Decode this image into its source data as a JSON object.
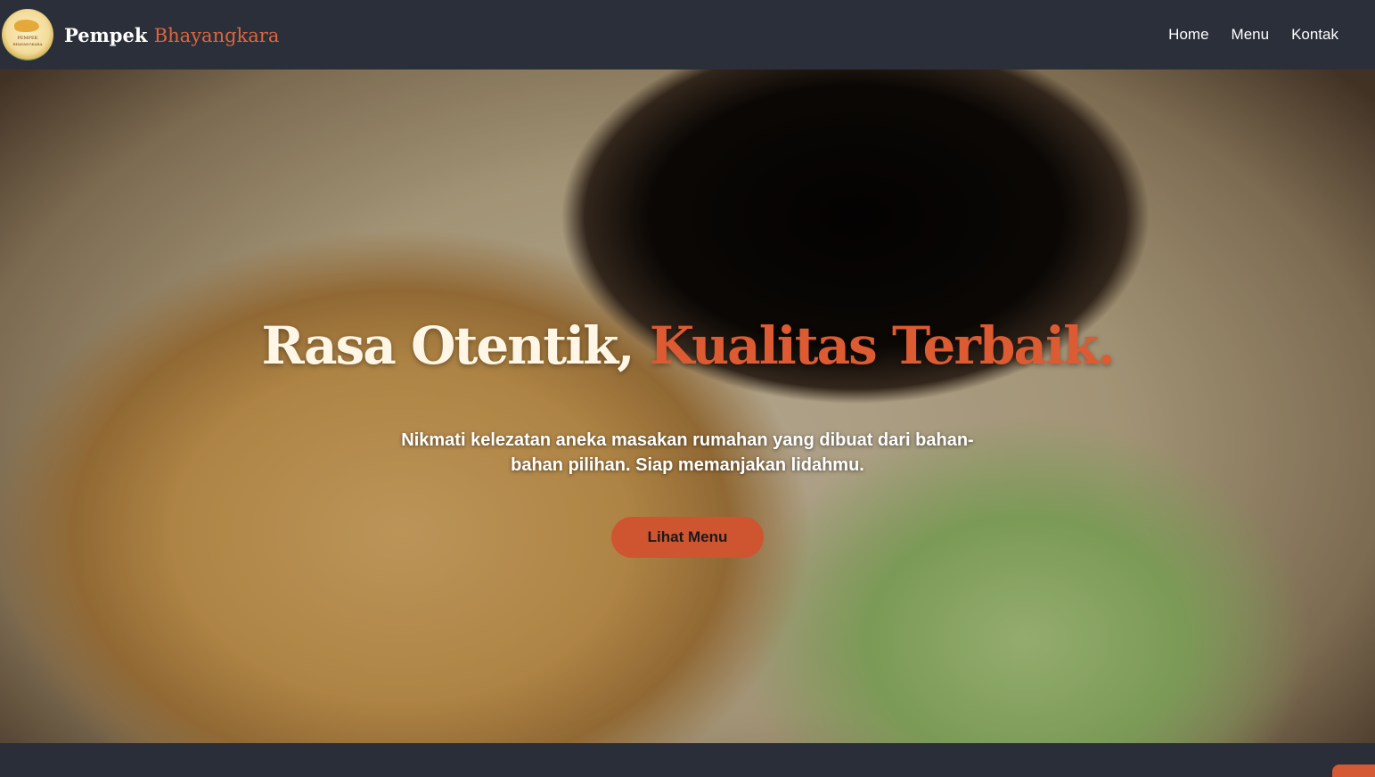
{
  "brand": {
    "name": "Pempek",
    "name_accent": "Bhayangkara",
    "logo_text_top": "PEMPEK",
    "logo_text_bottom": "BHAYANGKARA"
  },
  "nav": {
    "items": [
      {
        "label": "Home"
      },
      {
        "label": "Menu"
      },
      {
        "label": "Kontak"
      }
    ]
  },
  "hero": {
    "title_part1": "Rasa Otentik,",
    "title_part2": "Kualitas Terbaik.",
    "subtitle": "Nikmati kelezatan aneka masakan rumahan yang dibuat dari bahan-bahan pilihan. Siap memanjakan lidahmu.",
    "cta_label": "Lihat Menu"
  },
  "colors": {
    "navbar": "#2b2f39",
    "accent": "#dc5b32",
    "button": "#cf5430"
  }
}
